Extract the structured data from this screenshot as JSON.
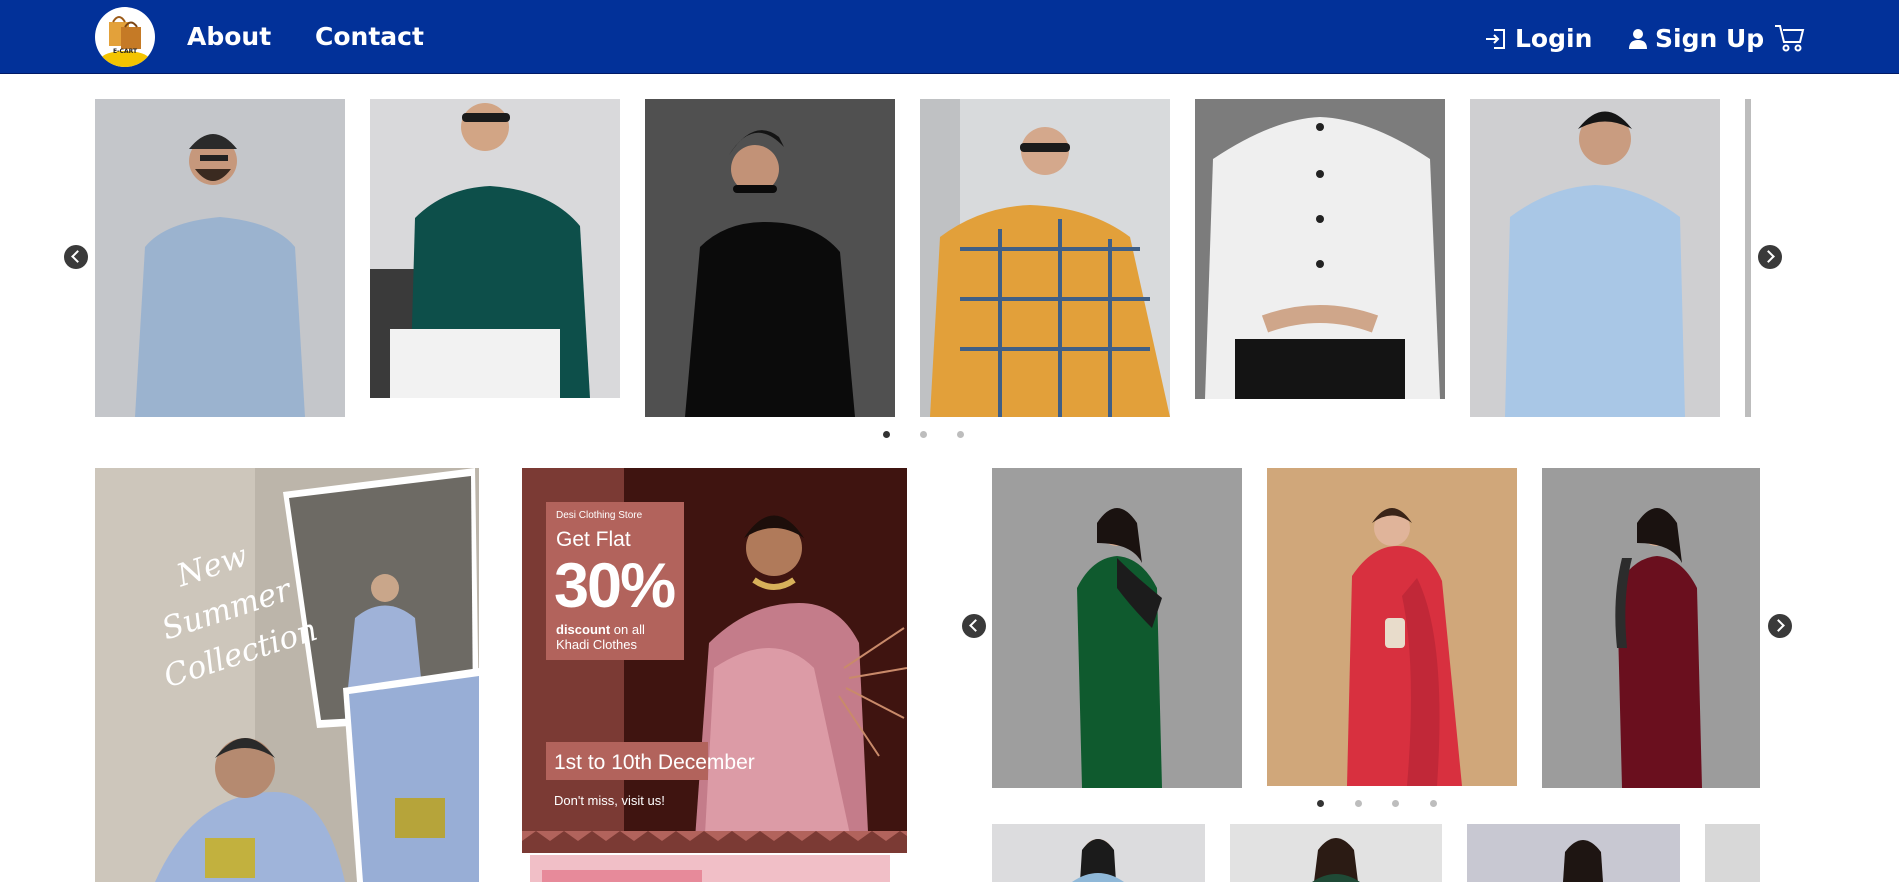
{
  "nav": {
    "logo_text": "E-CART",
    "about": "About",
    "contact": "Contact",
    "login": "Login",
    "signup": "Sign Up"
  },
  "icons": {
    "login": "login-icon",
    "signup": "user-icon",
    "cart": "cart-icon",
    "prev": "chevron-left-icon",
    "next": "chevron-right-icon"
  },
  "colors": {
    "navbar": "#023199",
    "sale_dark": "#3f1410",
    "sale_mid": "#7b3a34",
    "sale_box": "#b2635c"
  },
  "men_carousel": {
    "slides": [
      "shirt-blue-linen",
      "shirt-teal",
      "shirt-black",
      "shirt-mustard-check",
      "shirt-white",
      "shirt-sky-blue"
    ],
    "dots_total": 3,
    "active_dot": 1
  },
  "summer_banner": {
    "text": "New Summer Collection"
  },
  "sale_banner": {
    "store": "Desi Clothing Store",
    "get_flat": "Get Flat",
    "percent": "30%",
    "discount_bold": "discount",
    "discount_rest": " on all Khadi Clothes",
    "dates": "1st to 10th December",
    "visit": "Don't miss, visit us!"
  },
  "saree_carousel": {
    "slides": [
      "saree-green",
      "saree-red",
      "saree-maroon"
    ],
    "dots_total": 4,
    "active_dot": 1
  }
}
